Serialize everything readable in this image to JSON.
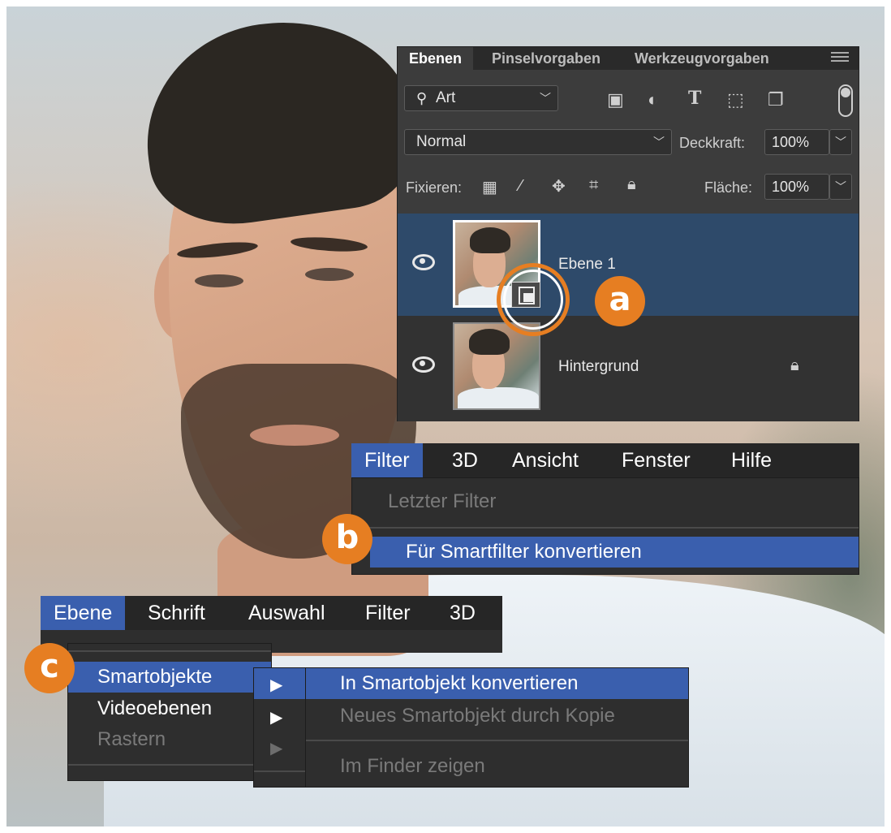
{
  "layers_panel": {
    "tabs": [
      "Ebenen",
      "Pinselvorgaben",
      "Werkzeugvorgaben"
    ],
    "kind_filter": "Art",
    "blend_mode": "Normal",
    "opacity_label": "Deckkraft:",
    "opacity_value": "100%",
    "lock_label": "Fixieren:",
    "fill_label": "Fläche:",
    "fill_value": "100%",
    "layers": [
      {
        "name": "Ebene 1",
        "selected": true,
        "smart_object": true
      },
      {
        "name": "Hintergrund",
        "selected": false,
        "locked": true
      }
    ]
  },
  "callouts": {
    "a": "a",
    "b": "b",
    "c": "c"
  },
  "filter_menu": {
    "bar": [
      "Filter",
      "3D",
      "Ansicht",
      "Fenster",
      "Hilfe"
    ],
    "items": [
      "Letzter Filter",
      "Für Smartfilter konvertieren"
    ]
  },
  "ebene_menu": {
    "bar": [
      "Ebene",
      "Schrift",
      "Auswahl",
      "Filter",
      "3D"
    ],
    "items": [
      "Smartobjekte",
      "Videoebenen",
      "Rastern"
    ]
  },
  "smart_submenu": {
    "items": [
      "In Smartobjekt konvertieren",
      "Neues Smartobjekt durch Kopie",
      "Im Finder zeigen"
    ]
  },
  "colors": {
    "accent": "#e67e22",
    "menu_highlight": "#3a5fae",
    "layer_selected": "#2e4a6a"
  }
}
